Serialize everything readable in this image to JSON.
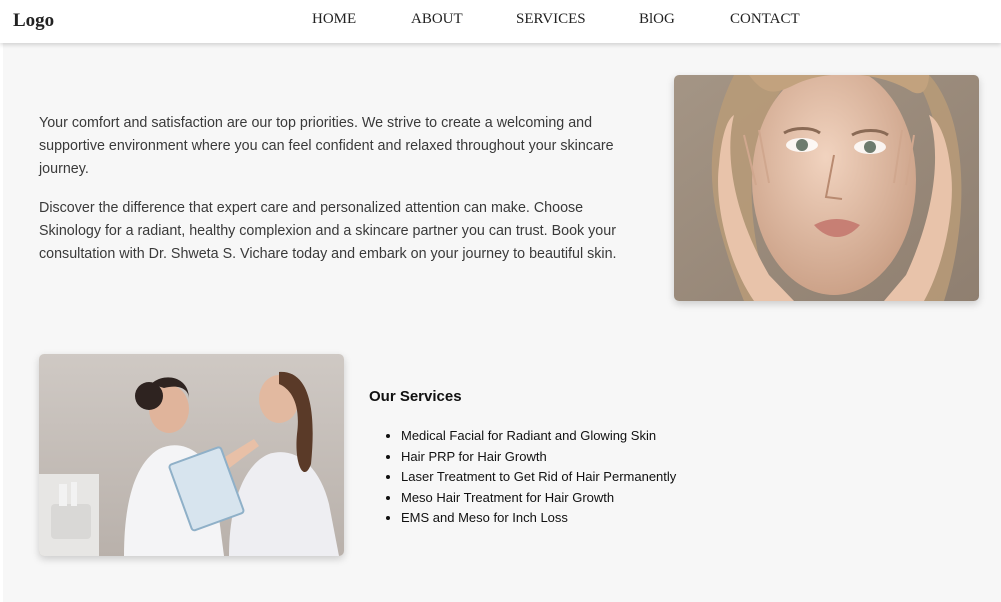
{
  "header": {
    "logo": "Logo",
    "nav": [
      "HOME",
      "ABOUT",
      "SERVICES",
      "BlOG",
      "CONTACT"
    ]
  },
  "intro": {
    "paragraphs": [
      "Your comfort and satisfaction are our top priorities. We strive to create a welcoming and supportive environment where you can feel confident and relaxed throughout your skincare journey.",
      "Discover the difference that expert care and personalized attention can make. Choose Skinology for a radiant, healthy complexion and a skincare partner you can trust. Book your consultation with Dr. Shweta S. Vichare today and embark on your journey to beautiful skin."
    ]
  },
  "services": {
    "title": "Our Services",
    "items": [
      "Medical Facial for Radiant and Glowing Skin",
      "Hair PRP for Hair Growth",
      "Laser Treatment to Get Rid of Hair Permanently",
      "Meso Hair Treatment for Hair Growth",
      "EMS and Meso for Inch Loss"
    ]
  },
  "colors": {
    "page_background": "#f7f7f7",
    "header_background": "#ffffff",
    "text": "#3a3a3a"
  }
}
